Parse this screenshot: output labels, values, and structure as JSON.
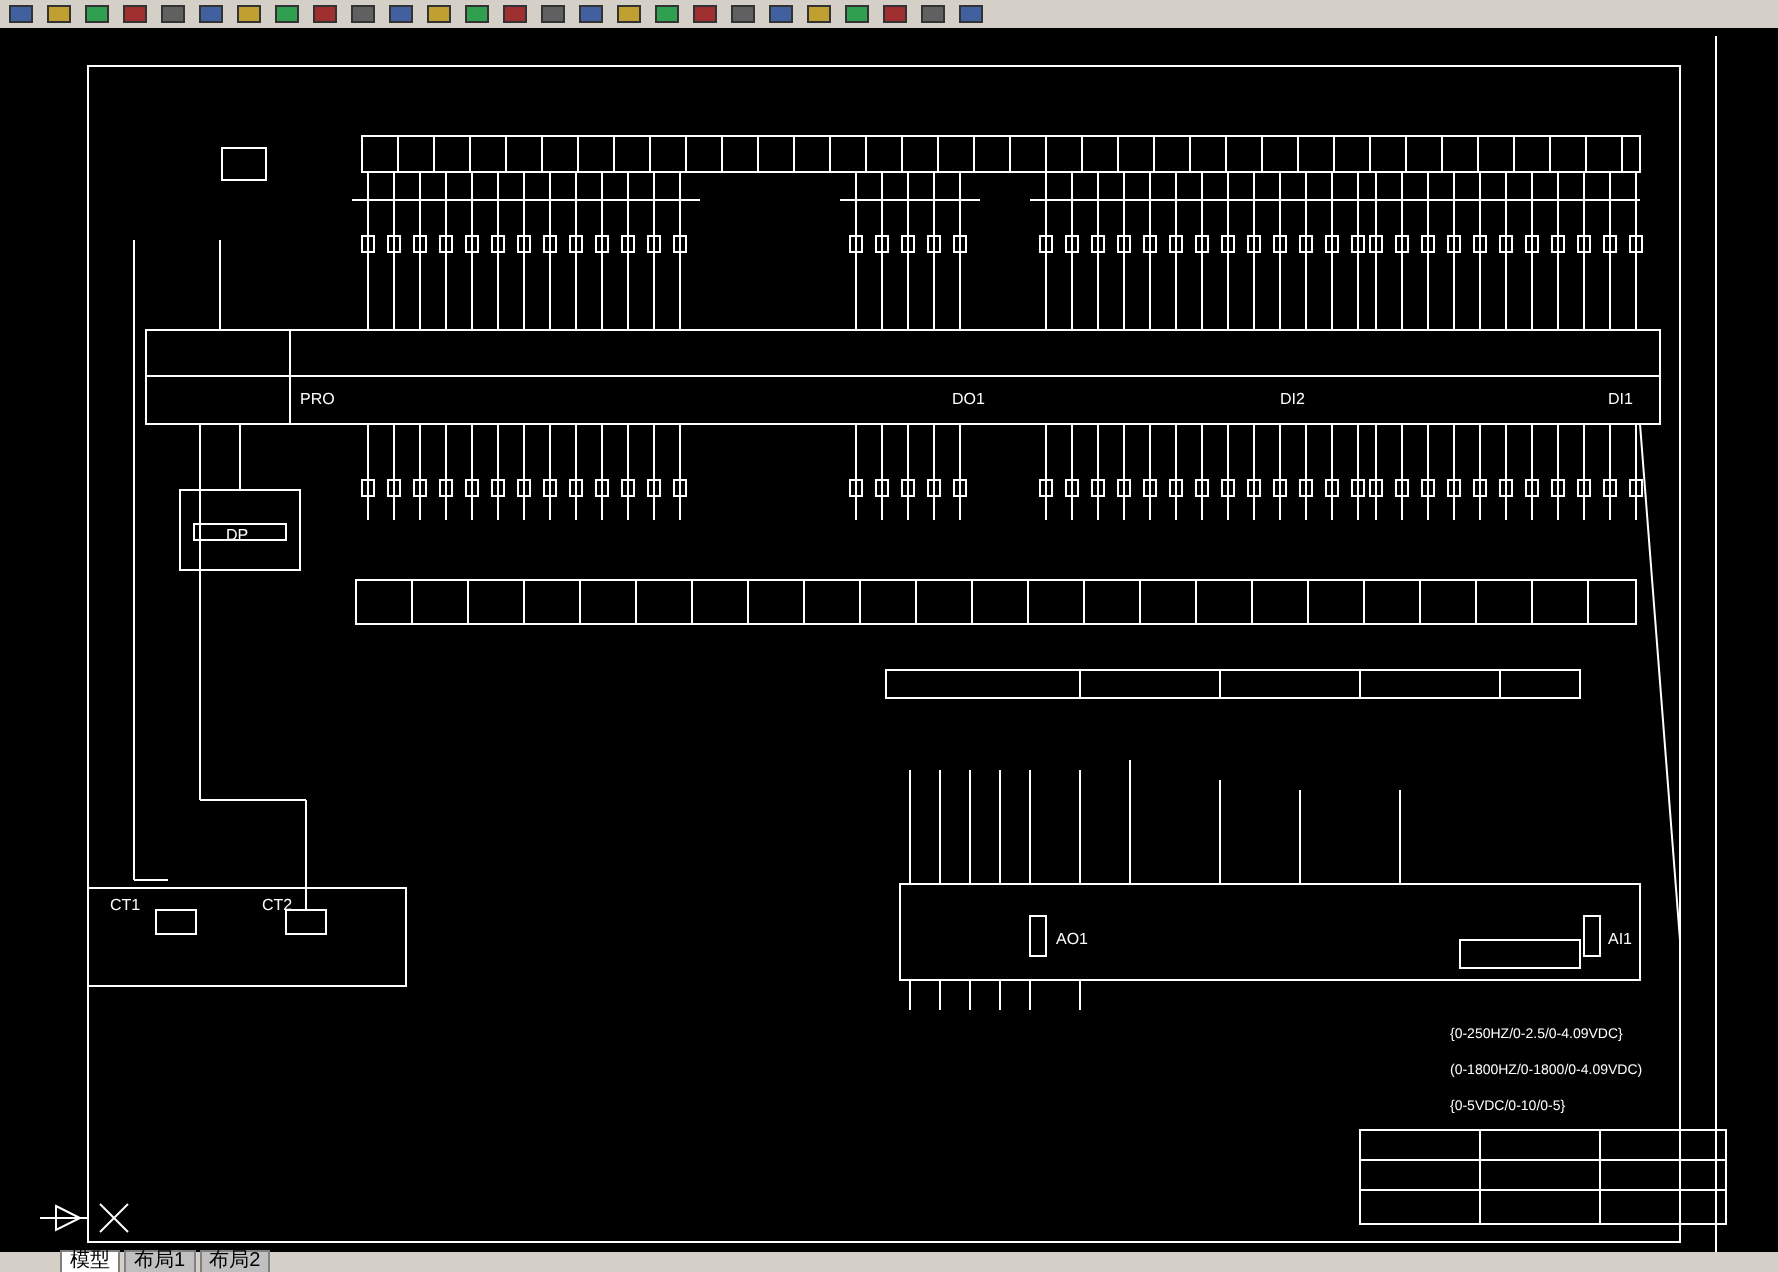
{
  "drawing": {
    "labels": [
      "PRO",
      "DO1",
      "DI2",
      "DI1",
      "DP",
      "AO1",
      "AI1",
      "CT1",
      "CT2"
    ],
    "specs": [
      "{0-250HZ/0-2.5/0-4.09VDC}",
      "(0-1800HZ/0-1800/0-4.09VDC)",
      "{0-5VDC/0-10/0-5}"
    ]
  },
  "layout_tabs": [
    {
      "label": "模型",
      "selected": true
    },
    {
      "label": "布局1",
      "selected": false
    },
    {
      "label": "布局2",
      "selected": false
    }
  ]
}
